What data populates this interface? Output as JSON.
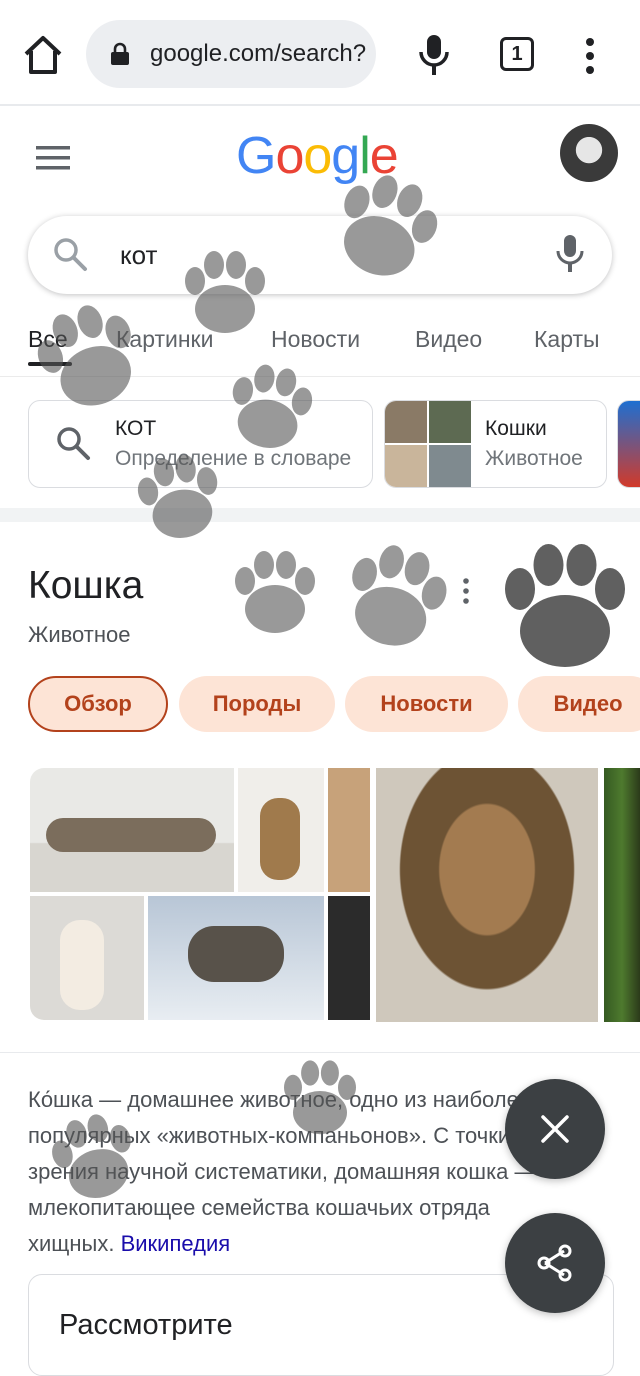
{
  "browser": {
    "url": "google.com/search?",
    "tab_count": "1"
  },
  "search": {
    "logo": "Google",
    "query": "кот"
  },
  "tabs": [
    {
      "label": "Все",
      "active": true
    },
    {
      "label": "Картинки"
    },
    {
      "label": "Новости"
    },
    {
      "label": "Видео"
    },
    {
      "label": "Карты"
    }
  ],
  "suggestions": [
    {
      "title": "КОТ",
      "subtitle": "Определение в словаре"
    },
    {
      "title": "Кошки",
      "subtitle": "Животное"
    }
  ],
  "knowledge_panel": {
    "title": "Кошка",
    "subtitle": "Животное",
    "pills": [
      "Обзор",
      "Породы",
      "Новости",
      "Видео"
    ],
    "description_lines": [
      "Ко́шка — домашнее животное, одно из наиболее",
      "популярных «животных-компаньонов». С точки",
      "зрения научной систематики, домашняя кошка —",
      "млекопитающее семейства кошачьих отряда",
      "хищных."
    ],
    "source_link": "Википедия",
    "card_title": "Рассмотрите"
  },
  "colors": {
    "accent": "#b3421c",
    "pill_bg": "#fde4d6",
    "link": "#1a0dab",
    "fab": "#3c4043"
  }
}
